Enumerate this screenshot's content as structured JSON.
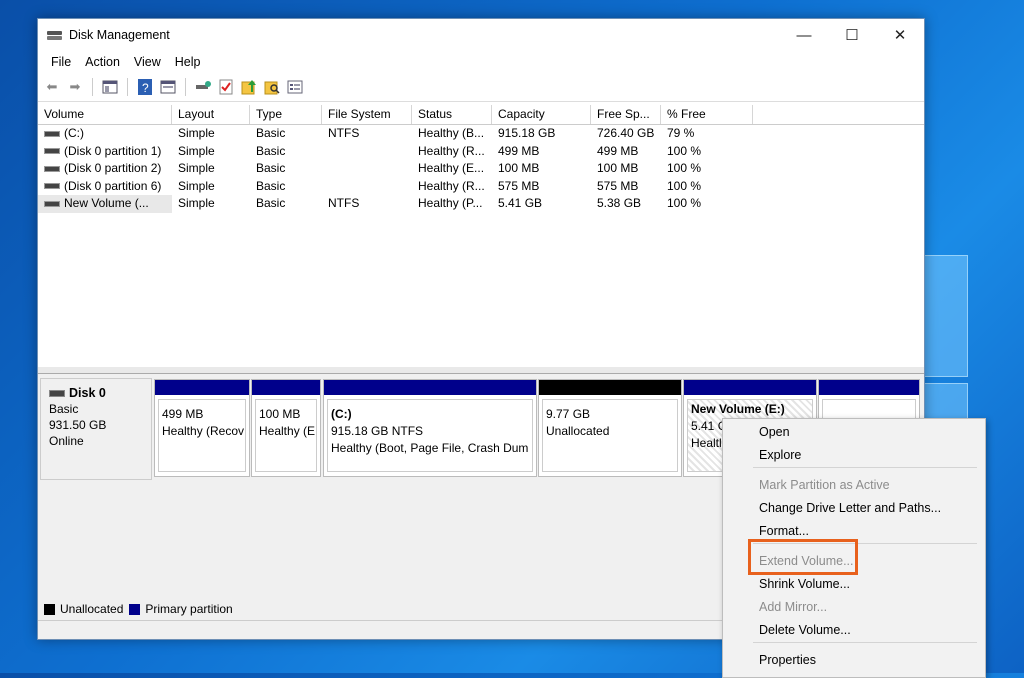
{
  "window": {
    "title": "Disk Management",
    "controls": {
      "minimize": "—",
      "maximize": "☐",
      "close": "✕"
    }
  },
  "menu": [
    "File",
    "Action",
    "View",
    "Help"
  ],
  "volume_list": {
    "columns": [
      "Volume",
      "Layout",
      "Type",
      "File System",
      "Status",
      "Capacity",
      "Free Sp...",
      "% Free"
    ],
    "rows": [
      {
        "volume": "(C:)",
        "layout": "Simple",
        "type": "Basic",
        "fs": "NTFS",
        "status": "Healthy (B...",
        "capacity": "915.18 GB",
        "free": "726.40 GB",
        "pct": "79 %"
      },
      {
        "volume": "(Disk 0 partition 1)",
        "layout": "Simple",
        "type": "Basic",
        "fs": "",
        "status": "Healthy (R...",
        "capacity": "499 MB",
        "free": "499 MB",
        "pct": "100 %"
      },
      {
        "volume": "(Disk 0 partition 2)",
        "layout": "Simple",
        "type": "Basic",
        "fs": "",
        "status": "Healthy (E...",
        "capacity": "100 MB",
        "free": "100 MB",
        "pct": "100 %"
      },
      {
        "volume": "(Disk 0 partition 6)",
        "layout": "Simple",
        "type": "Basic",
        "fs": "",
        "status": "Healthy (R...",
        "capacity": "575 MB",
        "free": "575 MB",
        "pct": "100 %"
      },
      {
        "volume": "New Volume (...",
        "layout": "Simple",
        "type": "Basic",
        "fs": "NTFS",
        "status": "Healthy (P...",
        "capacity": "5.41 GB",
        "free": "5.38 GB",
        "pct": "100 %"
      }
    ]
  },
  "disk": {
    "name": "Disk 0",
    "type": "Basic",
    "size": "931.50 GB",
    "state": "Online"
  },
  "partitions": [
    {
      "title": "",
      "line1": "499 MB",
      "line2": "Healthy (Recov"
    },
    {
      "title": "",
      "line1": "100 MB",
      "line2": "Healthy (E"
    },
    {
      "title": "(C:)",
      "line1": "915.18 GB NTFS",
      "line2": "Healthy (Boot, Page File, Crash Dum"
    },
    {
      "title": "",
      "line1": "9.77 GB",
      "line2": "Unallocated"
    },
    {
      "title": "New Volume  (E:)",
      "line1": "5.41 G",
      "line2": "Healtl"
    },
    {
      "title": "",
      "line1": "",
      "line2": ""
    }
  ],
  "legend": {
    "unallocated": "Unallocated",
    "primary": "Primary partition",
    "colors": {
      "unallocated": "#000000",
      "primary": "#00008b"
    }
  },
  "context_menu": {
    "items": [
      {
        "label": "Open",
        "enabled": true
      },
      {
        "label": "Explore",
        "enabled": true
      },
      {
        "label": "Mark Partition as Active",
        "enabled": false
      },
      {
        "label": "Change Drive Letter and Paths...",
        "enabled": true
      },
      {
        "label": "Format...",
        "enabled": true
      },
      {
        "label": "Extend Volume...",
        "enabled": false
      },
      {
        "label": "Shrink Volume...",
        "enabled": true
      },
      {
        "label": "Add Mirror...",
        "enabled": false
      },
      {
        "label": "Delete Volume...",
        "enabled": true
      },
      {
        "label": "Properties",
        "enabled": true
      }
    ],
    "highlight_color": "#e8611d"
  }
}
